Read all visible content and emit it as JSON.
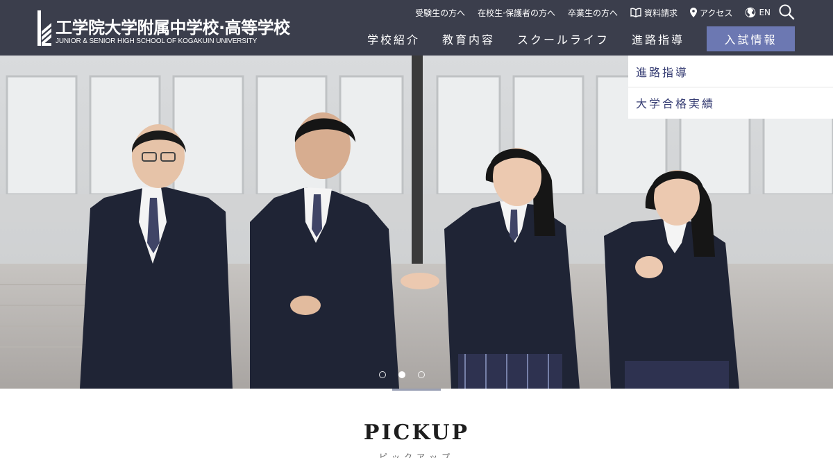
{
  "school": {
    "name_ja": "工学院大学附属中学校·高等学校",
    "name_en": "JUNIOR & SENIOR HIGH SCHOOL OF KOGAKUIN UNIVERSITY"
  },
  "utility_nav": [
    {
      "label": "受験生の方へ"
    },
    {
      "label": "在校生·保護者の方へ"
    },
    {
      "label": "卒業生の方へ"
    },
    {
      "label": "資料請求",
      "icon": "book-icon"
    },
    {
      "label": "アクセス",
      "icon": "map-pin-icon"
    },
    {
      "label": "EN",
      "icon": "globe-icon"
    }
  ],
  "search": {
    "icon": "search-icon"
  },
  "global_nav": {
    "items": [
      {
        "label": "学校紹介"
      },
      {
        "label": "教育内容"
      },
      {
        "label": "スクールライフ"
      },
      {
        "label": "進路指導"
      }
    ],
    "cta": {
      "label": "入試情報"
    }
  },
  "dropdown": {
    "items": [
      {
        "label": "進路指導"
      },
      {
        "label": "大学合格実績"
      }
    ]
  },
  "hero": {
    "slides_count": 3,
    "active_slide": 2
  },
  "pickup": {
    "title": "PICKUP",
    "subtitle": "ピックアップ"
  },
  "colors": {
    "header_bg": "#3b3e4c",
    "accent": "#6c78b2",
    "dropdown_text": "#343b72"
  }
}
